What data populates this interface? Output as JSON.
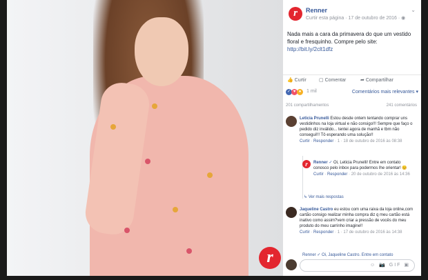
{
  "post": {
    "page_name": "Renner",
    "meta": "Curtir esta página · 17 de outubro de 2016 · ",
    "text": "Nada mais a cara da primavera do que um vestido floral e fresquinho. Compre pelo site:",
    "link": "http://bit.ly/2clt1dfz",
    "logo_letter": "r"
  },
  "actions": {
    "like": "Curtir",
    "comment": "Comentar",
    "share": "Compartilhar"
  },
  "reactions": {
    "count": "1 mil",
    "sort": "Comentários mais relevantes ▾"
  },
  "shares": {
    "left": "201 compartilhamentos",
    "right": "241 comentários"
  },
  "comments": [
    {
      "name": "Leticia Prunelli",
      "text": "Estou desde ontem tentando comprar uns vestidinhos na loja virtual e não consigo!!! Sempre que faço o pedido diz inválido... tentei agora de manhã e tbm não consegui!!! Tô esperando uma solução!!",
      "meta_like": "Curtir",
      "meta_reply": "Responder",
      "meta_rest": "· 1 · 18 de outubro de 2016 às 08:38"
    },
    {
      "name": "Renner",
      "text": "Oi, Leticia Prunelli! Entre em contato conosco pelo inbox para podermos lhe orientar! 😊",
      "meta_like": "Curtir",
      "meta_reply": "Responder",
      "meta_rest": "· 20 de outubro de 2016 às 14:36"
    },
    {
      "name": "Jaqueline Castro",
      "text": "eu estou com uma raiva da loja online,com cartão consigo realizar minha compra diz q meu cartão está inativo como assim?vem criar a pressão de vocês do meu produto do meu carrinho imagine!!",
      "meta_like": "Curtir",
      "meta_reply": "Responder",
      "meta_rest": "· 1 · 17 de outubro de 2016 às 14:38"
    }
  ],
  "more_replies": "↳ Ver mais respostas",
  "truncated_reply": "Renner ✓ Oi, Jaqueline Castro. Entre em contato",
  "composer_icons": "☺ 📷 GIF ▣",
  "colors": {
    "brand_red": "#e3262f",
    "fb_blue": "#365899",
    "reaction_like": "#4267b2",
    "reaction_love": "#f25268",
    "reaction_wow": "#f7b125"
  }
}
